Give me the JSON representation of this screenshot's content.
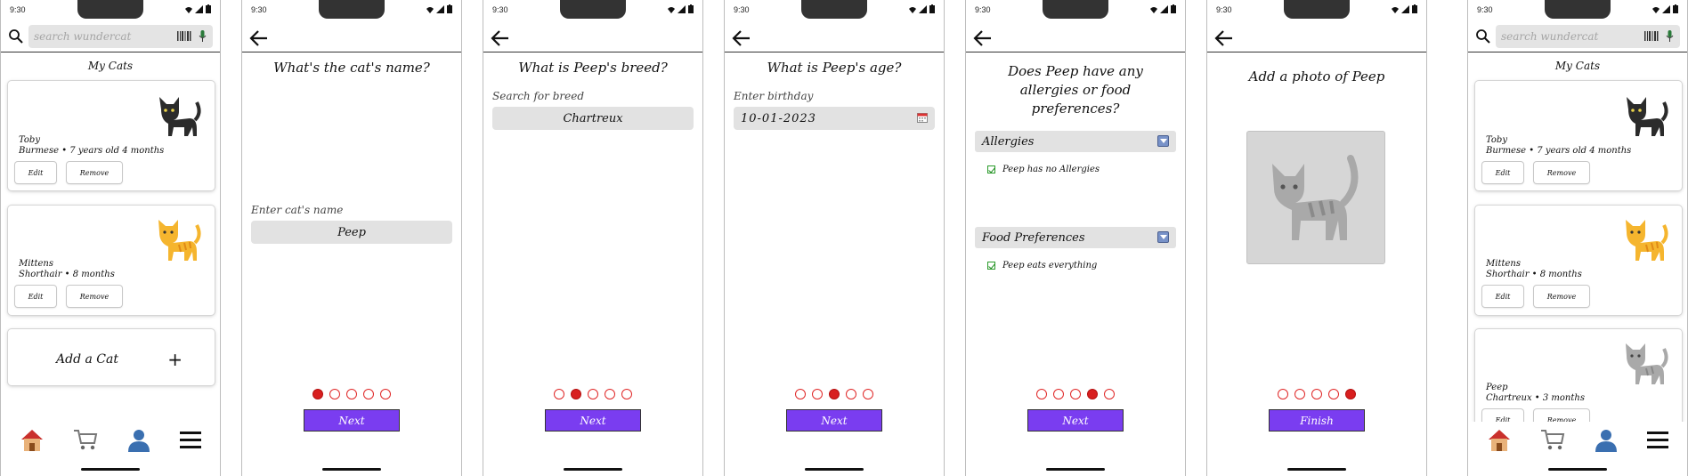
{
  "status": {
    "time": "9:30"
  },
  "search": {
    "placeholder": "search wundercat"
  },
  "list_screen": {
    "title": "My Cats",
    "cats": [
      {
        "name": "Toby",
        "details": "Burmese • 7 years old 4 months",
        "icon": "black-cat-icon"
      },
      {
        "name": "Mittens",
        "details": "Shorthair • 8 months",
        "icon": "orange-cat-icon"
      }
    ],
    "edit_label": "Edit",
    "remove_label": "Remove",
    "add_label": "Add a Cat"
  },
  "list_screen_updated": {
    "title": "My Cats",
    "cats": [
      {
        "name": "Toby",
        "details": "Burmese • 7 years old 4 months",
        "icon": "black-cat-icon"
      },
      {
        "name": "Mittens",
        "details": "Shorthair • 8 months",
        "icon": "orange-cat-icon"
      },
      {
        "name": "Peep",
        "details": "Chartreux • 3 months",
        "icon": "gray-cat-icon"
      }
    ],
    "edit_label": "Edit",
    "remove_label": "Remove"
  },
  "nav": [
    "home-icon",
    "cart-icon",
    "profile-icon",
    "menu-icon"
  ],
  "step_name": {
    "heading": "What's the cat's name?",
    "label": "Enter cat's name",
    "value": "Peep",
    "next": "Next",
    "step": 1,
    "total": 5
  },
  "step_breed": {
    "heading": "What is Peep's breed?",
    "label": "Search for breed",
    "value": "Chartreux",
    "next": "Next",
    "step": 2,
    "total": 5
  },
  "step_age": {
    "heading": "What is Peep's age?",
    "label": "Enter birthday",
    "value": "10-01-2023",
    "next": "Next",
    "step": 3,
    "total": 5
  },
  "step_allergies": {
    "heading": "Does Peep have any allergies or food preferences?",
    "allergies_label": "Allergies",
    "allergies_check": "Peep has no Allergies",
    "food_label": "Food Preferences",
    "food_check": "Peep eats everything",
    "next": "Next",
    "step": 4,
    "total": 5
  },
  "step_photo": {
    "heading": "Add a photo of Peep",
    "finish": "Finish",
    "step": 5,
    "total": 5
  },
  "colors": {
    "accent": "#7a3df0",
    "dot_active": "#d81f1f",
    "field_bg": "#e2e2e2"
  }
}
